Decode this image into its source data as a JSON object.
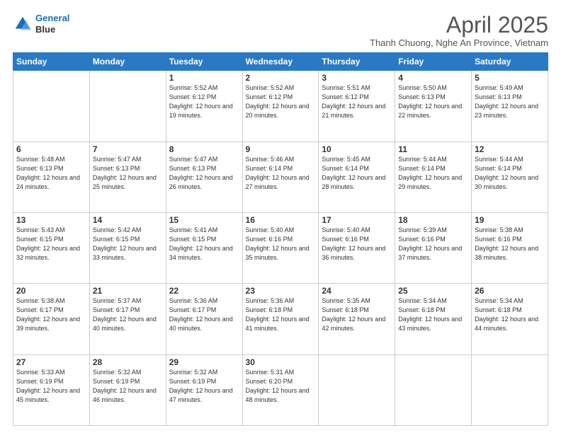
{
  "logo": {
    "line1": "General",
    "line2": "Blue"
  },
  "title": "April 2025",
  "location": "Thanh Chuong, Nghe An Province, Vietnam",
  "days_of_week": [
    "Sunday",
    "Monday",
    "Tuesday",
    "Wednesday",
    "Thursday",
    "Friday",
    "Saturday"
  ],
  "weeks": [
    [
      {
        "day": "",
        "sunrise": "",
        "sunset": "",
        "daylight": ""
      },
      {
        "day": "",
        "sunrise": "",
        "sunset": "",
        "daylight": ""
      },
      {
        "day": "1",
        "sunrise": "Sunrise: 5:52 AM",
        "sunset": "Sunset: 6:12 PM",
        "daylight": "Daylight: 12 hours and 19 minutes."
      },
      {
        "day": "2",
        "sunrise": "Sunrise: 5:52 AM",
        "sunset": "Sunset: 6:12 PM",
        "daylight": "Daylight: 12 hours and 20 minutes."
      },
      {
        "day": "3",
        "sunrise": "Sunrise: 5:51 AM",
        "sunset": "Sunset: 6:12 PM",
        "daylight": "Daylight: 12 hours and 21 minutes."
      },
      {
        "day": "4",
        "sunrise": "Sunrise: 5:50 AM",
        "sunset": "Sunset: 6:13 PM",
        "daylight": "Daylight: 12 hours and 22 minutes."
      },
      {
        "day": "5",
        "sunrise": "Sunrise: 5:49 AM",
        "sunset": "Sunset: 6:13 PM",
        "daylight": "Daylight: 12 hours and 23 minutes."
      }
    ],
    [
      {
        "day": "6",
        "sunrise": "Sunrise: 5:48 AM",
        "sunset": "Sunset: 6:13 PM",
        "daylight": "Daylight: 12 hours and 24 minutes."
      },
      {
        "day": "7",
        "sunrise": "Sunrise: 5:47 AM",
        "sunset": "Sunset: 6:13 PM",
        "daylight": "Daylight: 12 hours and 25 minutes."
      },
      {
        "day": "8",
        "sunrise": "Sunrise: 5:47 AM",
        "sunset": "Sunset: 6:13 PM",
        "daylight": "Daylight: 12 hours and 26 minutes."
      },
      {
        "day": "9",
        "sunrise": "Sunrise: 5:46 AM",
        "sunset": "Sunset: 6:14 PM",
        "daylight": "Daylight: 12 hours and 27 minutes."
      },
      {
        "day": "10",
        "sunrise": "Sunrise: 5:45 AM",
        "sunset": "Sunset: 6:14 PM",
        "daylight": "Daylight: 12 hours and 28 minutes."
      },
      {
        "day": "11",
        "sunrise": "Sunrise: 5:44 AM",
        "sunset": "Sunset: 6:14 PM",
        "daylight": "Daylight: 12 hours and 29 minutes."
      },
      {
        "day": "12",
        "sunrise": "Sunrise: 5:44 AM",
        "sunset": "Sunset: 6:14 PM",
        "daylight": "Daylight: 12 hours and 30 minutes."
      }
    ],
    [
      {
        "day": "13",
        "sunrise": "Sunrise: 5:43 AM",
        "sunset": "Sunset: 6:15 PM",
        "daylight": "Daylight: 12 hours and 32 minutes."
      },
      {
        "day": "14",
        "sunrise": "Sunrise: 5:42 AM",
        "sunset": "Sunset: 6:15 PM",
        "daylight": "Daylight: 12 hours and 33 minutes."
      },
      {
        "day": "15",
        "sunrise": "Sunrise: 5:41 AM",
        "sunset": "Sunset: 6:15 PM",
        "daylight": "Daylight: 12 hours and 34 minutes."
      },
      {
        "day": "16",
        "sunrise": "Sunrise: 5:40 AM",
        "sunset": "Sunset: 6:16 PM",
        "daylight": "Daylight: 12 hours and 35 minutes."
      },
      {
        "day": "17",
        "sunrise": "Sunrise: 5:40 AM",
        "sunset": "Sunset: 6:16 PM",
        "daylight": "Daylight: 12 hours and 36 minutes."
      },
      {
        "day": "18",
        "sunrise": "Sunrise: 5:39 AM",
        "sunset": "Sunset: 6:16 PM",
        "daylight": "Daylight: 12 hours and 37 minutes."
      },
      {
        "day": "19",
        "sunrise": "Sunrise: 5:38 AM",
        "sunset": "Sunset: 6:16 PM",
        "daylight": "Daylight: 12 hours and 38 minutes."
      }
    ],
    [
      {
        "day": "20",
        "sunrise": "Sunrise: 5:38 AM",
        "sunset": "Sunset: 6:17 PM",
        "daylight": "Daylight: 12 hours and 39 minutes."
      },
      {
        "day": "21",
        "sunrise": "Sunrise: 5:37 AM",
        "sunset": "Sunset: 6:17 PM",
        "daylight": "Daylight: 12 hours and 40 minutes."
      },
      {
        "day": "22",
        "sunrise": "Sunrise: 5:36 AM",
        "sunset": "Sunset: 6:17 PM",
        "daylight": "Daylight: 12 hours and 40 minutes."
      },
      {
        "day": "23",
        "sunrise": "Sunrise: 5:36 AM",
        "sunset": "Sunset: 6:18 PM",
        "daylight": "Daylight: 12 hours and 41 minutes."
      },
      {
        "day": "24",
        "sunrise": "Sunrise: 5:35 AM",
        "sunset": "Sunset: 6:18 PM",
        "daylight": "Daylight: 12 hours and 42 minutes."
      },
      {
        "day": "25",
        "sunrise": "Sunrise: 5:34 AM",
        "sunset": "Sunset: 6:18 PM",
        "daylight": "Daylight: 12 hours and 43 minutes."
      },
      {
        "day": "26",
        "sunrise": "Sunrise: 5:34 AM",
        "sunset": "Sunset: 6:18 PM",
        "daylight": "Daylight: 12 hours and 44 minutes."
      }
    ],
    [
      {
        "day": "27",
        "sunrise": "Sunrise: 5:33 AM",
        "sunset": "Sunset: 6:19 PM",
        "daylight": "Daylight: 12 hours and 45 minutes."
      },
      {
        "day": "28",
        "sunrise": "Sunrise: 5:32 AM",
        "sunset": "Sunset: 6:19 PM",
        "daylight": "Daylight: 12 hours and 46 minutes."
      },
      {
        "day": "29",
        "sunrise": "Sunrise: 5:32 AM",
        "sunset": "Sunset: 6:19 PM",
        "daylight": "Daylight: 12 hours and 47 minutes."
      },
      {
        "day": "30",
        "sunrise": "Sunrise: 5:31 AM",
        "sunset": "Sunset: 6:20 PM",
        "daylight": "Daylight: 12 hours and 48 minutes."
      },
      {
        "day": "",
        "sunrise": "",
        "sunset": "",
        "daylight": ""
      },
      {
        "day": "",
        "sunrise": "",
        "sunset": "",
        "daylight": ""
      },
      {
        "day": "",
        "sunrise": "",
        "sunset": "",
        "daylight": ""
      }
    ]
  ]
}
